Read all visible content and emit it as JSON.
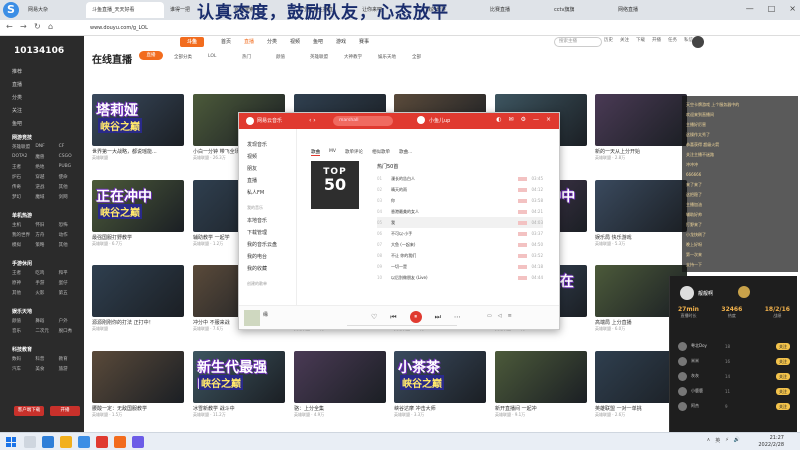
{
  "browser": {
    "tabs": [
      "网易大杂",
      "斗鱼直播_天天好看",
      "谁得一把",
      "百度搜索",
      "万宁搜索主播直",
      "让你来吧",
      "我的世界",
      "比赛直播",
      "cctv旗旗",
      "网络直播"
    ],
    "url": "www.douyu.com/g_LOL",
    "window_controls": [
      "—",
      "□",
      "×"
    ]
  },
  "overlay_text": "认真态度，鼓励队友，心态放平",
  "douyu": {
    "logo": "斗鱼",
    "nav": [
      "首页",
      "直播",
      "分类",
      "视频",
      "鱼吧",
      "游戏",
      "赛事"
    ],
    "nav_active": "直播",
    "search_placeholder": "搜索主播",
    "nav_icons": [
      "历史",
      "关注",
      "下载",
      "开播",
      "任务",
      "私信"
    ],
    "page_title": "在线直播",
    "live_pill": "直播",
    "filters": [
      "全部分类",
      "LOL",
      "热门",
      "颜值",
      "英雄联盟",
      "大神教学",
      "娱乐天地",
      "全部"
    ],
    "sidebar": {
      "number": "10134106",
      "menu": [
        "推荐",
        "直播",
        "分类",
        "关注",
        "鱼吧"
      ],
      "sections": [
        {
          "title": "网游竞技",
          "items": [
            "英雄联盟",
            "DNF",
            "CF",
            "DOTA2",
            "魔兽",
            "CSGO",
            "王者",
            "绝地",
            "PUBG",
            "炉石",
            "穿越",
            "使命",
            "传奇",
            "逆战",
            "其他",
            "梦幻",
            "魔域",
            "剑网"
          ]
        },
        {
          "title": "单机热游",
          "items": [
            "主机",
            "怀旧",
            "恐怖",
            "我的世界",
            "方舟",
            "动作",
            "模拟",
            "策略",
            "其他"
          ]
        },
        {
          "title": "手游休闲",
          "items": [
            "王者",
            "吃鸡",
            "和平",
            "原神",
            "手游",
            "蛋仔",
            "其他",
            "火影",
            "第五"
          ]
        },
        {
          "title": "娱乐天地",
          "items": [
            "颜值",
            "舞蹈",
            "户外",
            "音乐",
            "二次元",
            "脱口秀"
          ]
        },
        {
          "title": "科技教育",
          "items": [
            "数码",
            "科普",
            "教育",
            "汽车",
            "美食",
            "旅游"
          ]
        }
      ],
      "buttons": [
        "客户端下载",
        "开播"
      ]
    },
    "cards": [
      {
        "title": "世界第一大战略，都说瑶能...",
        "meta": "英雄联盟",
        "banner": "塔莉娅",
        "sub": "峡谷之巅"
      },
      {
        "title": "小白一分钟 带飞全场",
        "meta": "英雄联盟 · 26.3万",
        "banner": "",
        "sub": ""
      },
      {
        "title": "凌晨峡谷 冲分中",
        "meta": "英雄联盟 · 8.1万",
        "banner": "",
        "sub": ""
      },
      {
        "title": "新赛季上分 大乱斗",
        "meta": "英雄联盟 · 3.5万",
        "banner": "",
        "sub": ""
      },
      {
        "title": "巅峰冲榜 第一视角",
        "meta": "英雄联盟 · 12.4万",
        "banner": "",
        "sub": ""
      },
      {
        "title": "新的一天从上分开始",
        "meta": "英雄联盟 · 2.8万",
        "banner": "",
        "sub": ""
      },
      {
        "title": "最强国服打野教学",
        "meta": "英雄联盟 · 6.7万",
        "banner": "正在冲中",
        "sub": "峡谷之巅"
      },
      {
        "title": "辅助教学 一起学",
        "meta": "英雄联盟 · 1.2万",
        "banner": "",
        "sub": ""
      },
      {
        "title": "中单来了 快来围观",
        "meta": "英雄联盟 · 9.9万",
        "banner": "",
        "sub": ""
      },
      {
        "title": "老将回归 上单之王",
        "meta": "英雄联盟 · 4.4万",
        "banner": "",
        "sub": ""
      },
      {
        "title": "深夜上分 陪你聊天",
        "meta": "英雄联盟 · 1.7万",
        "banner": "JZ 正在冲中",
        "sub": "峡谷之巅"
      },
      {
        "title": "娱乐局 快乐游戏",
        "meta": "英雄联盟 · 5.3万",
        "banner": "",
        "sub": ""
      },
      {
        "title": "源源刚刚你的打法 正打中！",
        "meta": "英雄联盟",
        "banner": "",
        "sub": ""
      },
      {
        "title": "冲分中 不服来战",
        "meta": "英雄联盟 · 7.6万",
        "banner": "",
        "sub": ""
      },
      {
        "title": "一起来学打野",
        "meta": "英雄联盟 · 3.1万",
        "banner": "",
        "sub": ""
      },
      {
        "title": "路人王 教你上分",
        "meta": "英雄联盟 · 2.2万",
        "banner": "",
        "sub": ""
      },
      {
        "title": "火力全开 Reggy",
        "meta": "英雄联盟 · 8.8万",
        "banner": "小明晶 正在冲中",
        "sub": "峡谷之巅"
      },
      {
        "title": "高端局 上分直播",
        "meta": "英雄联盟 · 6.0万",
        "banner": "",
        "sub": ""
      },
      {
        "title": "腰酸一定：无敌国服教学",
        "meta": "英雄联盟 · 1.5万",
        "banner": "",
        "sub": ""
      },
      {
        "title": "冰雪新教学 战斗中",
        "meta": "英雄联盟 · 11.2万",
        "banner": "新生代最强KING",
        "sub": "峡谷之巅"
      },
      {
        "title": "骆：上分全集",
        "meta": "英雄联盟 · 4.9万",
        "banner": "",
        "sub": ""
      },
      {
        "title": "峡谷达摩 冲击大师",
        "meta": "英雄联盟 · 3.3万",
        "banner": "小茶茶",
        "sub": "峡谷之巅"
      },
      {
        "title": "新开直播间 一起冲",
        "meta": "英雄联盟 · 9.1万",
        "banner": "",
        "sub": ""
      },
      {
        "title": "英雄联盟 一对一单挑",
        "meta": "英雄联盟 · 2.6万",
        "banner": "",
        "sub": ""
      }
    ]
  },
  "music": {
    "app_name": "网易云音乐",
    "search_text": "marshall",
    "user": "小鱼儿up",
    "side": {
      "items": [
        "发现音乐",
        "视频",
        "朋友",
        "直播",
        "私人FM"
      ],
      "group1": "我的音乐",
      "items2": [
        "本地音乐",
        "下载管理",
        "我的音乐云盘",
        "我的电台",
        "我的收藏"
      ],
      "group2": "创建的歌单"
    },
    "tabs": [
      "歌曲",
      "MV",
      "歌单评论",
      "相似歌单",
      "歌曲..."
    ],
    "tab_active": "歌曲",
    "cover_line1": "TOP",
    "cover_line2": "50",
    "list_title": "热门50首",
    "songs": [
      {
        "rank": "01",
        "name": "漫长的告白人",
        "dur": "03:45"
      },
      {
        "rank": "02",
        "name": "晴天的雨",
        "dur": "04:12"
      },
      {
        "rank": "03",
        "name": "你",
        "dur": "03:58"
      },
      {
        "rank": "04",
        "name": "香港最美的女人",
        "dur": "04:21"
      },
      {
        "rank": "05",
        "name": "我",
        "dur": "04:03"
      },
      {
        "rank": "06",
        "name": "不可以·小手",
        "dur": "03:37"
      },
      {
        "rank": "07",
        "name": "大鱼 (一起来)",
        "dur": "04:50"
      },
      {
        "rank": "08",
        "name": "不让  你的我们",
        "dur": "03:52"
      },
      {
        "rank": "09",
        "name": "一切一是",
        "dur": "04:18"
      },
      {
        "rank": "10",
        "name": "以后别做朋友 (Live)",
        "dur": "04:44"
      }
    ],
    "now_playing": "缘",
    "controls": [
      "♡",
      "⏮",
      "⏸",
      "⏭",
      "⋯"
    ]
  },
  "streamer": {
    "name": "靓靓啊",
    "stats": [
      {
        "v": "27min",
        "k": "直播时长"
      },
      {
        "v": "32466",
        "k": "热度"
      },
      {
        "v": "18/2/16",
        "k": "战绩"
      }
    ],
    "rows": [
      {
        "name": "粤北Doy",
        "score": "18",
        "btn": "关注"
      },
      {
        "name": "米米",
        "score": "16",
        "btn": "关注"
      },
      {
        "name": "灰灰",
        "score": "14",
        "btn": "关注"
      },
      {
        "name": "小鹿鹿",
        "score": "11",
        "btn": "关注"
      },
      {
        "name": "阿杰",
        "score": "9",
        "btn": "关注"
      }
    ],
    "chat": [
      "天空卡牌游戏 上个服务器中的",
      "欢迎来到直播间",
      "主播好厉害",
      "这操作太秀了",
      "恭喜获得 超级火箭",
      "关注主播不迷路",
      "冲冲冲",
      "666666",
      "来了来了",
      "这把稳了",
      "主播加油",
      "辅助好帅",
      "打野来了",
      "小龙快刷了",
      "晚上好呀",
      "第一次来",
      "支持一下"
    ]
  },
  "taskbar": {
    "time": "21:27",
    "date": "2022/2/28",
    "tray": [
      "∧",
      "英",
      "⚡",
      "🔊"
    ]
  },
  "colors": {
    "douyu_orange": "#f26c1e",
    "netease_red": "#e03a30",
    "sidebar_dark": "#2b2b2b"
  }
}
